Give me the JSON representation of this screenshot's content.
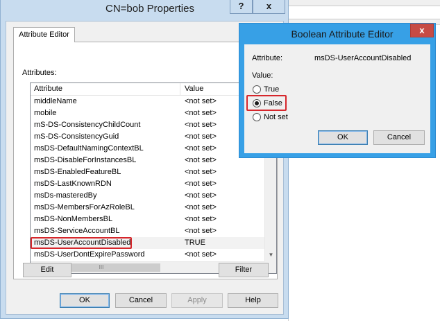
{
  "main_dialog": {
    "title": "CN=bob Properties",
    "help_button": "?",
    "close_button": "x",
    "tab": "Attribute Editor",
    "attributes_label": "Attributes:",
    "columns": [
      "Attribute",
      "Value"
    ],
    "rows": [
      {
        "attribute": "middleName",
        "value": "<not set>"
      },
      {
        "attribute": "mobile",
        "value": "<not set>"
      },
      {
        "attribute": "mS-DS-ConsistencyChildCount",
        "value": "<not set>"
      },
      {
        "attribute": "mS-DS-ConsistencyGuid",
        "value": "<not set>"
      },
      {
        "attribute": "msDS-DefaultNamingContextBL",
        "value": "<not set>"
      },
      {
        "attribute": "msDS-DisableForInstancesBL",
        "value": "<not set>"
      },
      {
        "attribute": "msDS-EnabledFeatureBL",
        "value": "<not set>"
      },
      {
        "attribute": "msDS-LastKnownRDN",
        "value": "<not set>"
      },
      {
        "attribute": "msDs-masteredBy",
        "value": "<not set>"
      },
      {
        "attribute": "msDS-MembersForAzRoleBL",
        "value": "<not set>"
      },
      {
        "attribute": "msDS-NonMembersBL",
        "value": "<not set>"
      },
      {
        "attribute": "msDS-ServiceAccountBL",
        "value": "<not set>"
      },
      {
        "attribute": "msDS-UserAccountDisabled",
        "value": "TRUE"
      },
      {
        "attribute": "msDS-UserDontExpirePassword",
        "value": "<not set>"
      }
    ],
    "scroll_thumb": "III",
    "edit_button": "Edit",
    "filter_button": "Filter",
    "ok_button": "OK",
    "cancel_button": "Cancel",
    "apply_button": "Apply",
    "help_label": "Help"
  },
  "bool_editor": {
    "title": "Boolean Attribute Editor",
    "close_button": "x",
    "attribute_label": "Attribute:",
    "attribute_value": "msDS-UserAccountDisabled",
    "value_label": "Value:",
    "options": [
      "True",
      "False",
      "Not set"
    ],
    "selected": "False",
    "ok_button": "OK",
    "cancel_button": "Cancel"
  },
  "colors": {
    "highlight": "#d6262b",
    "title_bar_active": "#37a0e6",
    "title_bar_inactive": "#c8dcef",
    "close_button": "#c74b45"
  }
}
